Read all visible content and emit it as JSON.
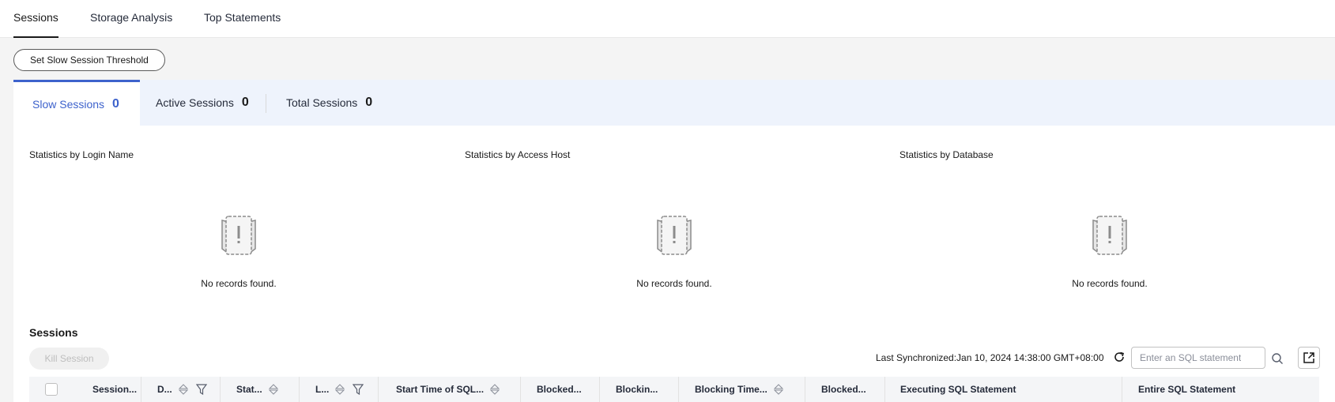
{
  "top_tabs": [
    {
      "label": "Sessions",
      "active": true
    },
    {
      "label": "Storage Analysis",
      "active": false
    },
    {
      "label": "Top Statements",
      "active": false
    }
  ],
  "threshold_button": "Set Slow Session Threshold",
  "session_tabs": [
    {
      "label": "Slow Sessions",
      "count": "0",
      "active": true
    },
    {
      "label": "Active Sessions",
      "count": "0",
      "active": false
    },
    {
      "label": "Total Sessions",
      "count": "0",
      "active": false
    }
  ],
  "stats": [
    {
      "title": "Statistics by Login Name",
      "empty_text": "No records found."
    },
    {
      "title": "Statistics by Access Host",
      "empty_text": "No records found."
    },
    {
      "title": "Statistics by Database",
      "empty_text": "No records found."
    }
  ],
  "sessions_section": {
    "title": "Sessions",
    "kill_button": "Kill Session",
    "last_sync": "Last Synchronized:Jan 10, 2024 14:38:00 GMT+08:00",
    "search_placeholder": "Enter an SQL statement."
  },
  "table_columns": [
    {
      "label": "Session...",
      "sortable": false,
      "filterable": false
    },
    {
      "label": "D...",
      "sortable": true,
      "filterable": true
    },
    {
      "label": "Stat...",
      "sortable": true,
      "filterable": false
    },
    {
      "label": "L...",
      "sortable": true,
      "filterable": true
    },
    {
      "label": "Start Time of SQL...",
      "sortable": true,
      "filterable": false
    },
    {
      "label": "Blocked...",
      "sortable": false,
      "filterable": false
    },
    {
      "label": "Blockin...",
      "sortable": false,
      "filterable": false
    },
    {
      "label": "Blocking Time...",
      "sortable": true,
      "filterable": false
    },
    {
      "label": "Blocked...",
      "sortable": false,
      "filterable": false
    },
    {
      "label": "Executing SQL Statement",
      "sortable": false,
      "filterable": false
    },
    {
      "label": "Entire SQL Statement",
      "sortable": false,
      "filterable": false
    }
  ],
  "colors": {
    "accent": "#3d62cc",
    "tab_bar_bg": "#eef3fc",
    "page_bg": "#f4f4f4"
  },
  "icons": [
    "empty-data-icon",
    "refresh-icon",
    "search-icon",
    "export-icon",
    "sort-icon",
    "filter-icon"
  ]
}
